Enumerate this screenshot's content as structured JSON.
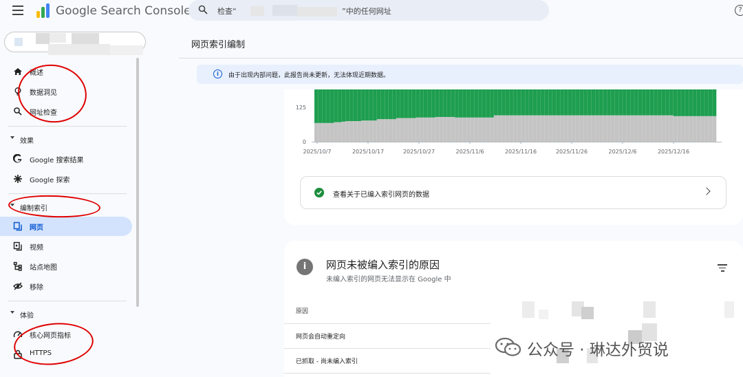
{
  "header": {
    "brand": "Google Search Console",
    "search_prefix": "检查“",
    "search_suffix": "”中的任何网址",
    "help_symbol": "?"
  },
  "sidebar": {
    "top_items": [
      {
        "label": "概述",
        "icon": "home-icon"
      },
      {
        "label": "数据洞见",
        "icon": "lightbulb-icon"
      },
      {
        "label": "网址检查",
        "icon": "search-icon"
      }
    ],
    "sections": [
      {
        "label": "效果",
        "items": [
          {
            "label": "Google 搜索结果",
            "icon": "google-g-icon"
          },
          {
            "label": "Google 探索",
            "icon": "asterisk-icon"
          }
        ]
      },
      {
        "label": "编制索引",
        "items": [
          {
            "label": "网页",
            "icon": "pages-icon",
            "active": true
          },
          {
            "label": "视频",
            "icon": "video-icon"
          },
          {
            "label": "站点地图",
            "icon": "sitemap-icon"
          },
          {
            "label": "移除",
            "icon": "eye-off-icon"
          }
        ]
      },
      {
        "label": "体验",
        "items": [
          {
            "label": "核心网页指标",
            "icon": "gauge-icon"
          },
          {
            "label": "HTTPS",
            "icon": "lock-icon"
          }
        ]
      }
    ]
  },
  "main": {
    "page_title": "网页索引编制",
    "banner_text": "由于出现内部问题，此报告尚未更新，无法体现近期数据。",
    "banner_icon": "i",
    "view_link": "查看关于已编入索引网页的数据",
    "reasons_card": {
      "info_icon": "i",
      "title": "网页未被编入索引的原因",
      "subtitle": "未编入索引的网页无法显示在 Google 中",
      "column_header": "原因",
      "rows": [
        "网页会自动重定向",
        "已抓取 - 尚未编入索引"
      ]
    }
  },
  "colors": {
    "indexed_green": "#1e9e4f",
    "not_indexed_gray": "#c4c4c4",
    "active_nav": "#d3e3fd",
    "banner_bg": "#e8f0fe"
  },
  "chart_data": {
    "type": "bar",
    "stacked": true,
    "y_ticks": [
      0,
      125
    ],
    "x_tick_labels": [
      "2025/10/7",
      "2025/10/17",
      "2025/10/27",
      "2025/11/6",
      "2025/11/16",
      "2025/11/26",
      "2025/12/6",
      "2025/12/16"
    ],
    "series": [
      {
        "color": "#c4c4c4",
        "values": [
          68,
          68,
          68,
          68,
          68,
          71,
          71,
          73,
          75,
          75,
          75,
          75,
          77,
          77,
          77,
          77,
          82,
          82,
          82,
          82,
          82,
          86,
          86,
          86,
          86,
          86,
          88,
          88,
          88,
          88,
          88,
          90,
          90,
          90,
          90,
          90,
          88,
          88,
          88,
          88,
          88,
          88,
          88,
          88,
          88,
          88,
          96,
          96,
          96,
          96,
          96,
          96,
          96,
          96,
          96,
          96,
          96,
          96,
          96,
          96,
          96,
          96,
          96,
          96,
          96,
          96,
          96,
          96,
          96,
          96,
          96,
          96,
          96,
          96,
          96,
          96,
          96,
          96,
          96,
          96,
          96,
          96,
          96,
          96,
          96,
          96,
          96,
          96,
          96,
          96,
          96,
          96,
          93,
          93,
          93,
          93,
          93,
          93,
          93,
          93,
          93,
          93,
          93
        ]
      },
      {
        "color": "#1e9e4f",
        "values": [
          122,
          122,
          122,
          122,
          122,
          119,
          119,
          117,
          115,
          115,
          115,
          115,
          113,
          113,
          113,
          113,
          108,
          108,
          108,
          108,
          108,
          104,
          104,
          104,
          104,
          104,
          102,
          102,
          102,
          102,
          102,
          100,
          100,
          100,
          100,
          100,
          102,
          102,
          102,
          102,
          102,
          102,
          102,
          102,
          102,
          102,
          94,
          94,
          94,
          94,
          94,
          94,
          94,
          94,
          94,
          94,
          94,
          94,
          94,
          94,
          94,
          94,
          94,
          94,
          94,
          94,
          94,
          94,
          94,
          94,
          94,
          94,
          94,
          94,
          94,
          94,
          94,
          94,
          94,
          94,
          94,
          94,
          94,
          94,
          94,
          94,
          94,
          94,
          94,
          94,
          94,
          94,
          97,
          97,
          97,
          97,
          97,
          97,
          97,
          97,
          97,
          97,
          97
        ]
      }
    ]
  },
  "annotations": "red hand-drawn ovals",
  "watermark": {
    "text": "公众号 · 琳达外贸说"
  }
}
